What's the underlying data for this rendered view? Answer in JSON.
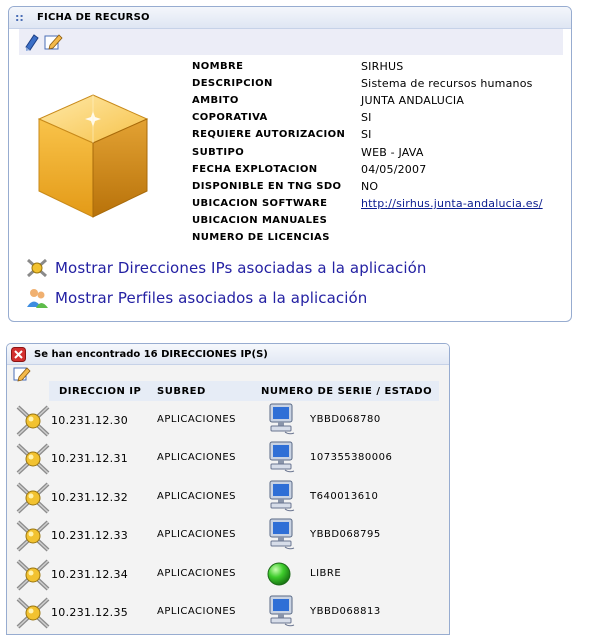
{
  "resource_panel": {
    "grip": "::",
    "title": "FICHA DE RECURSO",
    "toolbar_icons": [
      "edit-doc-icon",
      "edit-pencil-icon"
    ],
    "fields": [
      {
        "label": "NOMBRE",
        "value": "SIRHUS"
      },
      {
        "label": "DESCRIPCION",
        "value": "Sistema de recursos humanos"
      },
      {
        "label": "AMBITO",
        "value": "JUNTA ANDALUCIA"
      },
      {
        "label": "COPORATIVA",
        "value": "SI"
      },
      {
        "label": "REQUIERE AUTORIZACION",
        "value": "SI"
      },
      {
        "label": "SUBTIPO",
        "value": "WEB - JAVA"
      },
      {
        "label": "FECHA EXPLOTACION",
        "value": "04/05/2007"
      },
      {
        "label": "DISPONIBLE EN TNG SDO",
        "value": "NO"
      },
      {
        "label": "UBICACION SOFTWARE",
        "value": "http://sirhus.junta-andalucia.es/"
      },
      {
        "label": "UBICACION MANUALES",
        "value": ""
      },
      {
        "label": "NUMERO DE LICENCIAS",
        "value": ""
      }
    ],
    "actions": [
      {
        "label": "Mostrar Direcciones IPs asociadas a la aplicación",
        "icon": "network-ip-icon"
      },
      {
        "label": "Mostrar Perfiles asociados a la aplicación",
        "icon": "users-profiles-icon"
      }
    ]
  },
  "ip_panel": {
    "title": "Se han encontrado 16 DIRECCIONES IP(S)",
    "columns": [
      "DIRECCION IP",
      "SUBRED",
      "NUMERO DE SERIE / ESTADO"
    ],
    "rows": [
      {
        "ip": "10.231.12.30",
        "subnet": "APLICACIONES",
        "status_icon": "computer-icon",
        "serial": "YBBD068780"
      },
      {
        "ip": "10.231.12.31",
        "subnet": "APLICACIONES",
        "status_icon": "computer-icon",
        "serial": "107355380006"
      },
      {
        "ip": "10.231.12.32",
        "subnet": "APLICACIONES",
        "status_icon": "computer-icon",
        "serial": "T640013610"
      },
      {
        "ip": "10.231.12.33",
        "subnet": "APLICACIONES",
        "status_icon": "computer-icon",
        "serial": "YBBD068795"
      },
      {
        "ip": "10.231.12.34",
        "subnet": "APLICACIONES",
        "status_icon": "green-light-icon",
        "serial": "LIBRE"
      },
      {
        "ip": "10.231.12.35",
        "subnet": "APLICACIONES",
        "status_icon": "computer-icon",
        "serial": "YBBD068813"
      }
    ]
  },
  "colors": {
    "panel_border": "#97acd0",
    "action_text": "#2421a3",
    "link": "#0b1d8f",
    "close_red": "#d32f2f"
  }
}
